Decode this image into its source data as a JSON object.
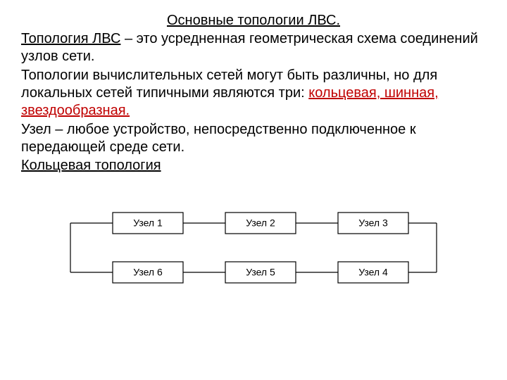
{
  "title": "Основные топологии ЛВС.",
  "text": {
    "term": "Топология ЛВС",
    "p1_rest": " – это усредненная геометрическая схема соединений узлов сети.",
    "p2_a": "Топологии вычислительных сетей могут быть различны, но для локальных сетей типичными являются три: ",
    "p2_link": "кольцевая, шинная, звездообразная.",
    "p3": "Узел – любое устройство, непосредственно подключенное к передающей среде сети.",
    "subheading": " Кольцевая топология"
  },
  "nodes": {
    "n1": "Узел 1",
    "n2": "Узел 2",
    "n3": "Узел 3",
    "n4": "Узел 4",
    "n5": "Узел 5",
    "n6": "Узел 6"
  }
}
